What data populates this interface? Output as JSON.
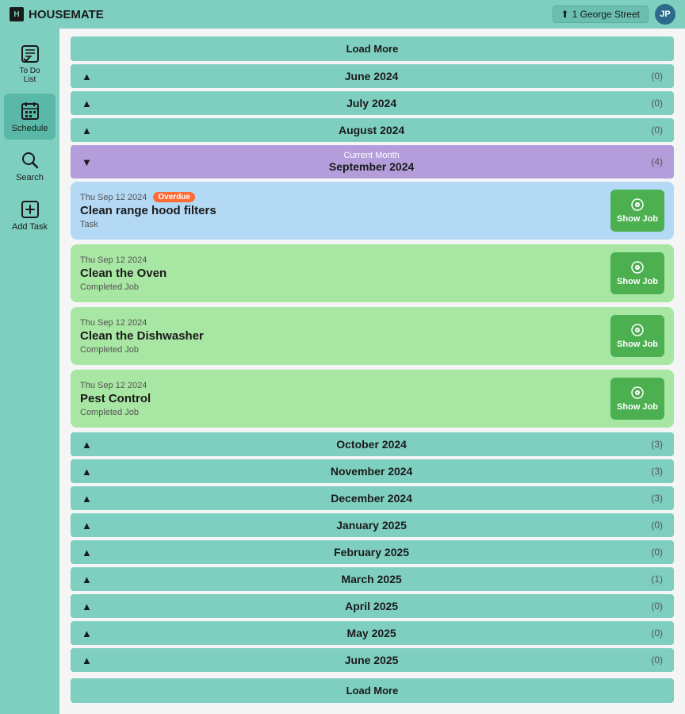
{
  "header": {
    "logo_text": "HOUSEMATE",
    "address": "1 George Street",
    "avatar_initials": "JP"
  },
  "sidebar": {
    "items": [
      {
        "id": "todo",
        "label": "To Do\nList",
        "active": false
      },
      {
        "id": "schedule",
        "label": "Schedule",
        "active": true
      },
      {
        "id": "search",
        "label": "Search",
        "active": false
      },
      {
        "id": "add-task",
        "label": "Add Task",
        "active": false
      }
    ]
  },
  "main": {
    "load_more_top": "Load More",
    "load_more_bottom": "Load More",
    "months": [
      {
        "id": "june-2024",
        "label": "June 2024",
        "count": 0,
        "expanded": false,
        "current": false
      },
      {
        "id": "july-2024",
        "label": "July 2024",
        "count": 0,
        "expanded": false,
        "current": false
      },
      {
        "id": "august-2024",
        "label": "August 2024",
        "count": 0,
        "expanded": false,
        "current": false
      },
      {
        "id": "sep-2024",
        "label": "September 2024",
        "count": 4,
        "expanded": true,
        "current": true,
        "current_label": "Current Month"
      },
      {
        "id": "oct-2024",
        "label": "October 2024",
        "count": 3,
        "expanded": false,
        "current": false
      },
      {
        "id": "nov-2024",
        "label": "November 2024",
        "count": 3,
        "expanded": false,
        "current": false
      },
      {
        "id": "dec-2024",
        "label": "December 2024",
        "count": 3,
        "expanded": false,
        "current": false
      },
      {
        "id": "jan-2025",
        "label": "January 2025",
        "count": 0,
        "expanded": false,
        "current": false
      },
      {
        "id": "feb-2025",
        "label": "February 2025",
        "count": 0,
        "expanded": false,
        "current": false
      },
      {
        "id": "mar-2025",
        "label": "March 2025",
        "count": 1,
        "expanded": false,
        "current": false
      },
      {
        "id": "apr-2025",
        "label": "April 2025",
        "count": 0,
        "expanded": false,
        "current": false
      },
      {
        "id": "may-2025",
        "label": "May 2025",
        "count": 0,
        "expanded": false,
        "current": false
      },
      {
        "id": "jun-2025",
        "label": "June 2025",
        "count": 0,
        "expanded": false,
        "current": false
      }
    ],
    "tasks": [
      {
        "id": "task-1",
        "date": "Thu Sep 12 2024",
        "overdue": true,
        "overdue_label": "Overdue",
        "title": "Clean range hood filters",
        "subtitle": "Task",
        "type": "blue",
        "show_job_label": "Show Job"
      },
      {
        "id": "task-2",
        "date": "Thu Sep 12 2024",
        "overdue": false,
        "title": "Clean the Oven",
        "subtitle": "Completed Job",
        "type": "green",
        "show_job_label": "Show Job"
      },
      {
        "id": "task-3",
        "date": "Thu Sep 12 2024",
        "overdue": false,
        "title": "Clean the Dishwasher",
        "subtitle": "Completed Job",
        "type": "green",
        "show_job_label": "Show Job"
      },
      {
        "id": "task-4",
        "date": "Thu Sep 12 2024",
        "overdue": false,
        "title": "Pest Control",
        "subtitle": "Completed Job",
        "type": "green",
        "show_job_label": "Show Job"
      }
    ]
  }
}
